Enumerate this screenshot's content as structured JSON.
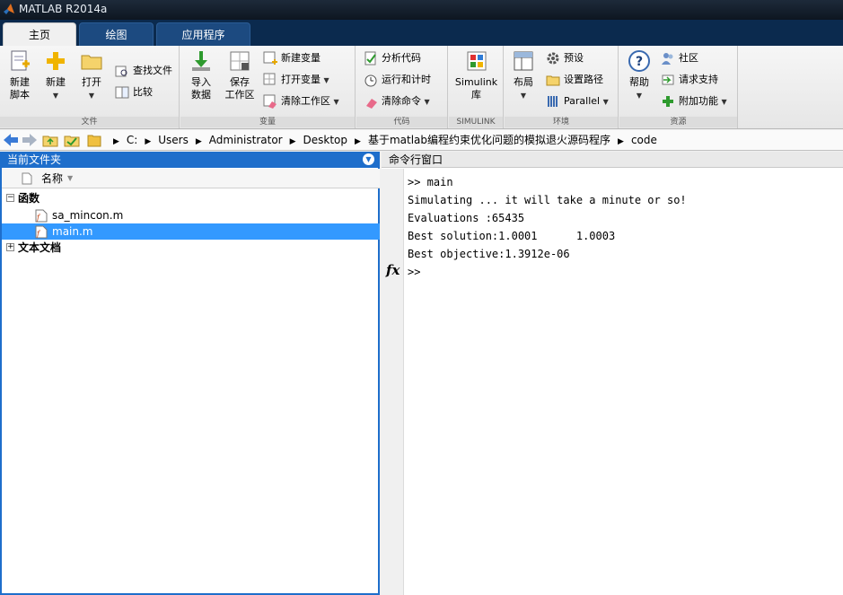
{
  "window": {
    "title": "MATLAB R2014a"
  },
  "tabs": [
    {
      "label": "主页"
    },
    {
      "label": "绘图"
    },
    {
      "label": "应用程序"
    }
  ],
  "ribbon": {
    "file": {
      "label": "文件",
      "new_script": "新建\n脚本",
      "new": "新建",
      "open": "打开",
      "find_files": "查找文件",
      "compare": "比较"
    },
    "variable": {
      "label": "变量",
      "import": "导入\n数据",
      "save_workspace": "保存\n工作区",
      "new_variable": "新建变量",
      "open_variable": "打开变量",
      "clear_workspace": "清除工作区"
    },
    "code": {
      "label": "代码",
      "analyze": "分析代码",
      "run_time": "运行和计时",
      "clear_commands": "清除命令"
    },
    "simulink": {
      "label": "SIMULINK",
      "button": "Simulink\n库"
    },
    "environment": {
      "label": "环境",
      "layout": "布局",
      "preferences": "预设",
      "set_path": "设置路径",
      "parallel": "Parallel"
    },
    "resources": {
      "label": "资源",
      "help": "帮助",
      "community": "社区",
      "request_support": "请求支持",
      "addons": "附加功能"
    }
  },
  "address": {
    "segments": [
      "C:",
      "Users",
      "Administrator",
      "Desktop",
      "基于matlab编程约束优化问题的模拟退火源码程序",
      "code"
    ]
  },
  "current_folder": {
    "title": "当前文件夹",
    "column_name": "名称",
    "groups": [
      {
        "label": "函数",
        "expanded": true,
        "files": [
          "sa_mincon.m",
          "main.m"
        ]
      },
      {
        "label": "文本文档",
        "expanded": false,
        "files": []
      }
    ],
    "selected_file": "main.m"
  },
  "command_window": {
    "title": "命令行窗口",
    "lines": [
      ">> main",
      "Simulating ... it will take a minute or so!",
      "Evaluations :65435",
      "Best solution:1.0001      1.0003",
      "Best objective:1.3912e-06",
      ">>"
    ],
    "fx_label": "fx"
  },
  "colors": {
    "accent": "#1e6ecb",
    "selection": "#3399ff",
    "tab_bar": "#0b2a4e"
  }
}
